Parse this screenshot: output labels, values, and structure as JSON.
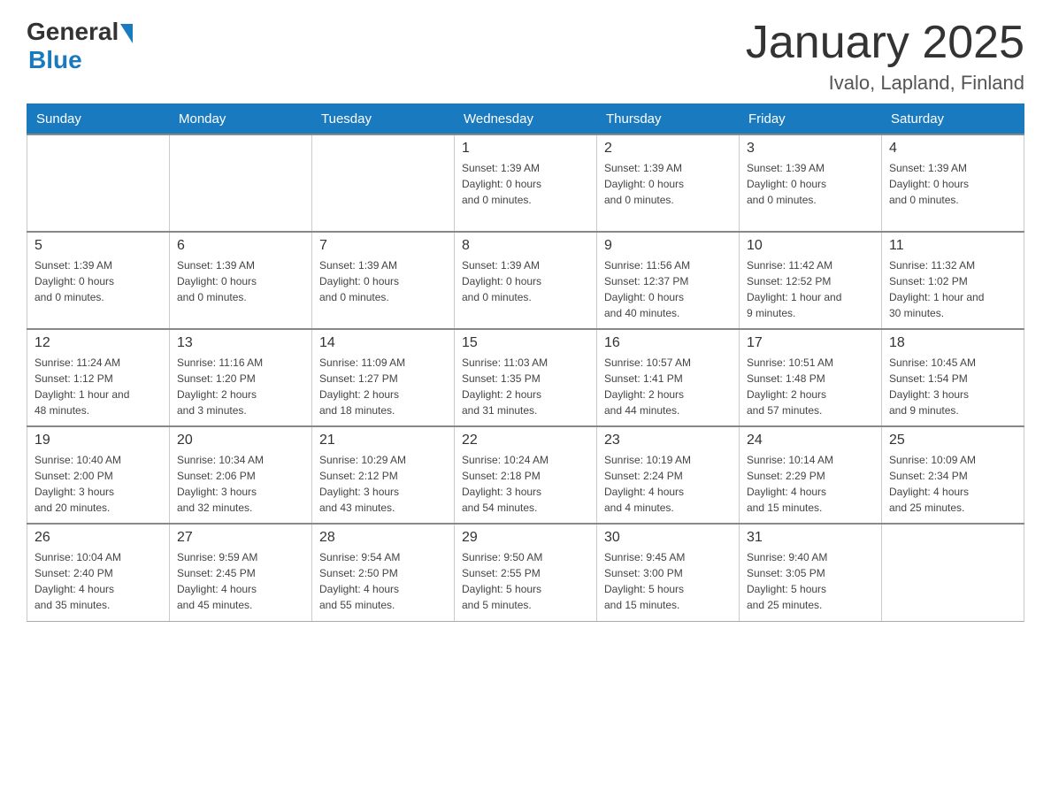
{
  "header": {
    "title": "January 2025",
    "location": "Ivalo, Lapland, Finland",
    "logo_general": "General",
    "logo_blue": "Blue"
  },
  "days_of_week": [
    "Sunday",
    "Monday",
    "Tuesday",
    "Wednesday",
    "Thursday",
    "Friday",
    "Saturday"
  ],
  "weeks": [
    [
      {
        "day": "",
        "info": ""
      },
      {
        "day": "",
        "info": ""
      },
      {
        "day": "",
        "info": ""
      },
      {
        "day": "1",
        "info": "Sunset: 1:39 AM\nDaylight: 0 hours\nand 0 minutes."
      },
      {
        "day": "2",
        "info": "Sunset: 1:39 AM\nDaylight: 0 hours\nand 0 minutes."
      },
      {
        "day": "3",
        "info": "Sunset: 1:39 AM\nDaylight: 0 hours\nand 0 minutes."
      },
      {
        "day": "4",
        "info": "Sunset: 1:39 AM\nDaylight: 0 hours\nand 0 minutes."
      }
    ],
    [
      {
        "day": "5",
        "info": "Sunset: 1:39 AM\nDaylight: 0 hours\nand 0 minutes."
      },
      {
        "day": "6",
        "info": "Sunset: 1:39 AM\nDaylight: 0 hours\nand 0 minutes."
      },
      {
        "day": "7",
        "info": "Sunset: 1:39 AM\nDaylight: 0 hours\nand 0 minutes."
      },
      {
        "day": "8",
        "info": "Sunset: 1:39 AM\nDaylight: 0 hours\nand 0 minutes."
      },
      {
        "day": "9",
        "info": "Sunrise: 11:56 AM\nSunset: 12:37 PM\nDaylight: 0 hours\nand 40 minutes."
      },
      {
        "day": "10",
        "info": "Sunrise: 11:42 AM\nSunset: 12:52 PM\nDaylight: 1 hour and\n9 minutes."
      },
      {
        "day": "11",
        "info": "Sunrise: 11:32 AM\nSunset: 1:02 PM\nDaylight: 1 hour and\n30 minutes."
      }
    ],
    [
      {
        "day": "12",
        "info": "Sunrise: 11:24 AM\nSunset: 1:12 PM\nDaylight: 1 hour and\n48 minutes."
      },
      {
        "day": "13",
        "info": "Sunrise: 11:16 AM\nSunset: 1:20 PM\nDaylight: 2 hours\nand 3 minutes."
      },
      {
        "day": "14",
        "info": "Sunrise: 11:09 AM\nSunset: 1:27 PM\nDaylight: 2 hours\nand 18 minutes."
      },
      {
        "day": "15",
        "info": "Sunrise: 11:03 AM\nSunset: 1:35 PM\nDaylight: 2 hours\nand 31 minutes."
      },
      {
        "day": "16",
        "info": "Sunrise: 10:57 AM\nSunset: 1:41 PM\nDaylight: 2 hours\nand 44 minutes."
      },
      {
        "day": "17",
        "info": "Sunrise: 10:51 AM\nSunset: 1:48 PM\nDaylight: 2 hours\nand 57 minutes."
      },
      {
        "day": "18",
        "info": "Sunrise: 10:45 AM\nSunset: 1:54 PM\nDaylight: 3 hours\nand 9 minutes."
      }
    ],
    [
      {
        "day": "19",
        "info": "Sunrise: 10:40 AM\nSunset: 2:00 PM\nDaylight: 3 hours\nand 20 minutes."
      },
      {
        "day": "20",
        "info": "Sunrise: 10:34 AM\nSunset: 2:06 PM\nDaylight: 3 hours\nand 32 minutes."
      },
      {
        "day": "21",
        "info": "Sunrise: 10:29 AM\nSunset: 2:12 PM\nDaylight: 3 hours\nand 43 minutes."
      },
      {
        "day": "22",
        "info": "Sunrise: 10:24 AM\nSunset: 2:18 PM\nDaylight: 3 hours\nand 54 minutes."
      },
      {
        "day": "23",
        "info": "Sunrise: 10:19 AM\nSunset: 2:24 PM\nDaylight: 4 hours\nand 4 minutes."
      },
      {
        "day": "24",
        "info": "Sunrise: 10:14 AM\nSunset: 2:29 PM\nDaylight: 4 hours\nand 15 minutes."
      },
      {
        "day": "25",
        "info": "Sunrise: 10:09 AM\nSunset: 2:34 PM\nDaylight: 4 hours\nand 25 minutes."
      }
    ],
    [
      {
        "day": "26",
        "info": "Sunrise: 10:04 AM\nSunset: 2:40 PM\nDaylight: 4 hours\nand 35 minutes."
      },
      {
        "day": "27",
        "info": "Sunrise: 9:59 AM\nSunset: 2:45 PM\nDaylight: 4 hours\nand 45 minutes."
      },
      {
        "day": "28",
        "info": "Sunrise: 9:54 AM\nSunset: 2:50 PM\nDaylight: 4 hours\nand 55 minutes."
      },
      {
        "day": "29",
        "info": "Sunrise: 9:50 AM\nSunset: 2:55 PM\nDaylight: 5 hours\nand 5 minutes."
      },
      {
        "day": "30",
        "info": "Sunrise: 9:45 AM\nSunset: 3:00 PM\nDaylight: 5 hours\nand 15 minutes."
      },
      {
        "day": "31",
        "info": "Sunrise: 9:40 AM\nSunset: 3:05 PM\nDaylight: 5 hours\nand 25 minutes."
      },
      {
        "day": "",
        "info": ""
      }
    ]
  ]
}
